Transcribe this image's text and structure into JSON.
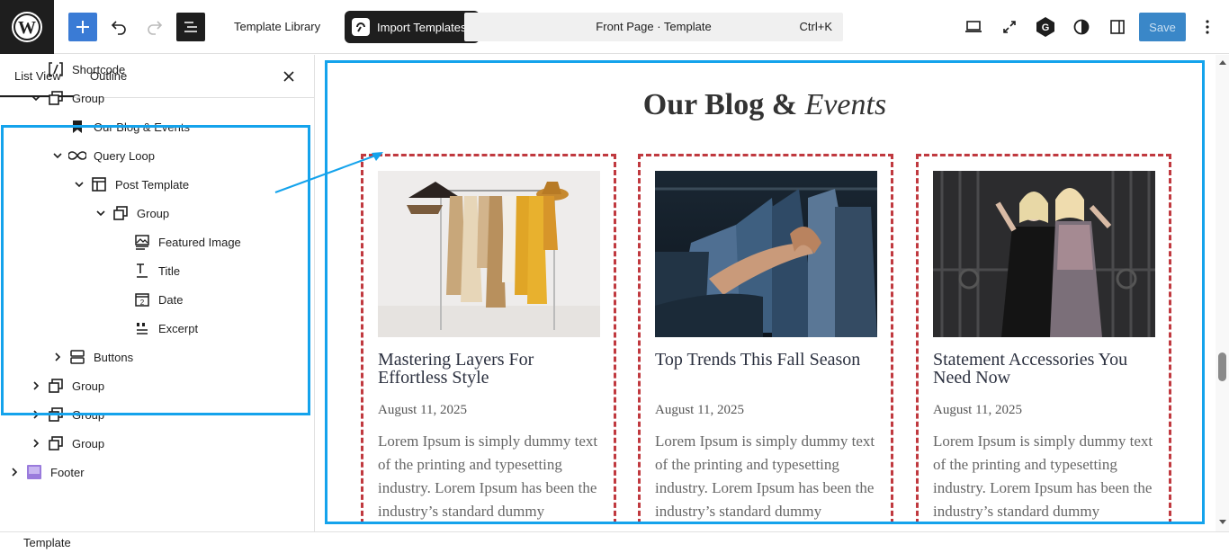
{
  "toolbar": {
    "template_library_label": "Template Library",
    "import_label": "Import Templates",
    "document_title": "Front Page · Template",
    "shortcut": "Ctrl+K",
    "save_label": "Save",
    "icons": [
      "wordpress-logo-icon",
      "add-block-icon",
      "undo-icon",
      "redo-icon",
      "document-overview-icon",
      "desktop-view-icon",
      "fullscreen-icon",
      "plugin-g-icon",
      "style-contrast-icon",
      "settings-sidebar-icon",
      "more-options-icon"
    ]
  },
  "left_panel": {
    "tabs": [
      "List View",
      "Outline"
    ],
    "active_tab": "List View",
    "tree": [
      {
        "label": "Shortcode",
        "icon": "shortcode-icon",
        "depth": 0,
        "chevron": "none"
      },
      {
        "label": "Group",
        "icon": "group-icon",
        "depth": 0,
        "chevron": "down"
      },
      {
        "label": "Our Blog & Events",
        "icon": "bookmark-icon",
        "depth": 1,
        "chevron": "none"
      },
      {
        "label": "Query Loop",
        "icon": "loop-icon",
        "depth": 1,
        "chevron": "down"
      },
      {
        "label": "Post Template",
        "icon": "layout-icon",
        "depth": 2,
        "chevron": "down"
      },
      {
        "label": "Group",
        "icon": "group-icon",
        "depth": 3,
        "chevron": "down"
      },
      {
        "label": "Featured Image",
        "icon": "featured-image-icon",
        "depth": 4,
        "chevron": "none"
      },
      {
        "label": "Title",
        "icon": "title-icon",
        "depth": 4,
        "chevron": "none"
      },
      {
        "label": "Date",
        "icon": "date-icon",
        "depth": 4,
        "chevron": "none"
      },
      {
        "label": "Excerpt",
        "icon": "excerpt-icon",
        "depth": 4,
        "chevron": "none"
      },
      {
        "label": "Buttons",
        "icon": "buttons-icon",
        "depth": 1,
        "chevron": "right"
      },
      {
        "label": "Group",
        "icon": "group-icon",
        "depth": 0,
        "chevron": "right"
      },
      {
        "label": "Group",
        "icon": "group-icon",
        "depth": 0,
        "chevron": "right"
      },
      {
        "label": "Group",
        "icon": "group-icon",
        "depth": 0,
        "chevron": "right"
      },
      {
        "label": "Footer",
        "icon": "footer-icon",
        "depth": -1,
        "chevron": "right"
      }
    ]
  },
  "canvas": {
    "heading_main": "Our Blog &",
    "heading_italic": "Events",
    "posts": [
      {
        "title": "Mastering Layers For Effortless Style",
        "date": "August 11, 2025",
        "excerpt": "Lorem Ipsum is simply dummy text of the printing and typesetting industry. Lorem Ipsum has been the industry’s standard dummy",
        "image": "clothes-rack-photo"
      },
      {
        "title": "Top Trends This Fall Season",
        "date": "August 11, 2025",
        "excerpt": "Lorem Ipsum is simply dummy text of the printing and typesetting industry. Lorem Ipsum has been the industry’s standard dummy",
        "image": "hand-on-hangers-photo"
      },
      {
        "title": "Statement Accessories You Need Now",
        "date": "August 11, 2025",
        "excerpt": "Lorem Ipsum is simply dummy text of the printing and typesetting industry. Lorem Ipsum has been the industry’s standard dummy",
        "image": "two-women-fashion-photo"
      }
    ]
  },
  "status_bar": {
    "label": "Template"
  },
  "colors": {
    "accent": "#14a3ec",
    "dashed_border": "#c0393f",
    "save_bg": "#3a87c8",
    "dark": "#1e1e1e"
  }
}
